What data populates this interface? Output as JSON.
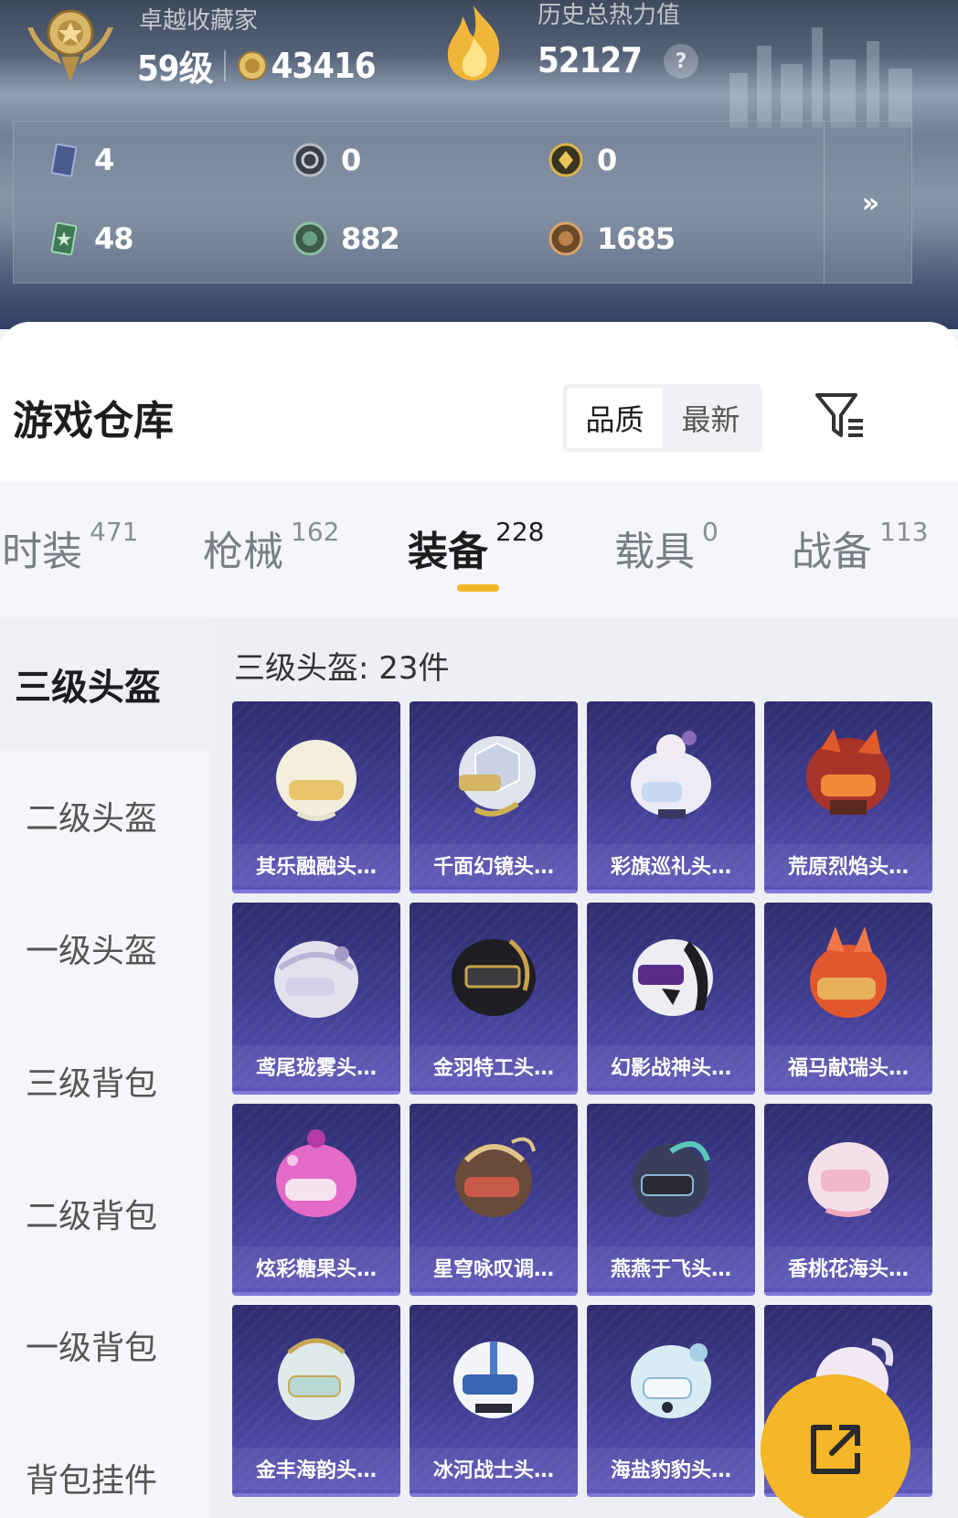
{
  "header": {
    "rank_title": "卓越收藏家",
    "level": "59级",
    "coins": "43416",
    "heat_label": "历史总热力值",
    "heat_value": "52127",
    "help_glyph": "?"
  },
  "stats": [
    {
      "icon": "card-icon",
      "value": "4"
    },
    {
      "icon": "silver-token-icon",
      "value": "0"
    },
    {
      "icon": "gold-token-icon",
      "value": "0"
    },
    {
      "icon": "green-card-icon",
      "value": "48"
    },
    {
      "icon": "green-coin-icon",
      "value": "882"
    },
    {
      "icon": "bronze-coin-icon",
      "value": "1685"
    }
  ],
  "more_arrow": "»",
  "warehouse": {
    "title": "游戏仓库",
    "sort_options": [
      "品质",
      "最新"
    ],
    "sort_active": 0
  },
  "tabs": [
    {
      "label": "时装",
      "count": "471"
    },
    {
      "label": "枪械",
      "count": "162"
    },
    {
      "label": "装备",
      "count": "228"
    },
    {
      "label": "载具",
      "count": "0"
    },
    {
      "label": "战备",
      "count": "113"
    }
  ],
  "active_tab": 2,
  "categories": [
    "三级头盔",
    "二级头盔",
    "一级头盔",
    "三级背包",
    "二级背包",
    "一级背包",
    "背包挂件"
  ],
  "active_category": 0,
  "section_count": "三级头盔: 23件",
  "items": [
    "其乐融融头…",
    "千面幻镜头…",
    "彩旗巡礼头…",
    "荒原烈焰头…",
    "鸢尾珑雾头…",
    "金羽特工头…",
    "幻影战神头…",
    "福马献瑞头…",
    "炫彩糖果头…",
    "星穹咏叹调…",
    "燕燕于飞头…",
    "香桃花海头…",
    "金丰海韵头…",
    "冰河战士头…",
    "海盐豹豹头…",
    "…"
  ],
  "colors": {
    "accent": "#f5b627",
    "card_top": "#2f2d6e",
    "card_bottom": "#5a54b8"
  }
}
